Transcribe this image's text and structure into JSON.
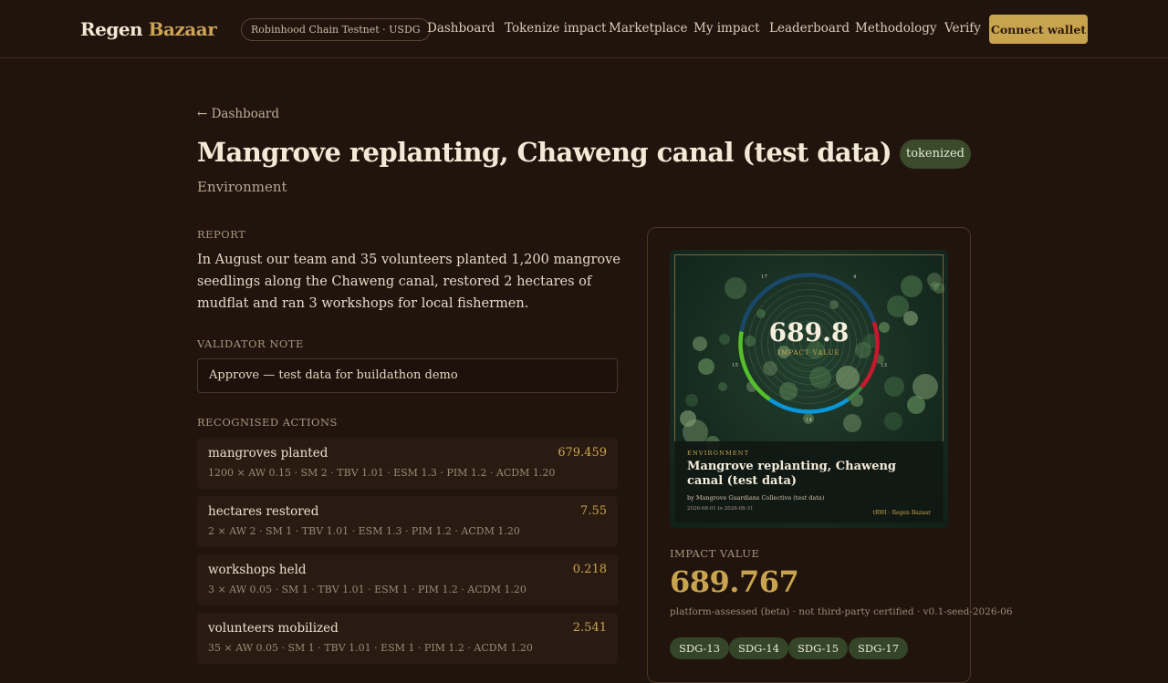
{
  "header": {
    "brand_part1": "Regen",
    "brand_part2": "Bazaar",
    "chain": "Robinhood Chain Testnet · USDG",
    "nav": [
      {
        "label": "Dashboard"
      },
      {
        "label": "Tokenize impact"
      },
      {
        "label": "Marketplace"
      },
      {
        "label": "My impact"
      },
      {
        "label": "Leaderboard"
      },
      {
        "label": "Methodology"
      },
      {
        "label": "Verify"
      }
    ],
    "connect_label": "Connect wallet"
  },
  "page": {
    "back_label": "← Dashboard",
    "title": "Mangrove replanting, Chaweng canal (test data)",
    "category": "Environment",
    "status": "tokenized"
  },
  "report": {
    "label": "REPORT",
    "text": "In August our team and 35 volunteers planted 1,200 mangrove seedlings along the Chaweng canal, restored 2 hectares of mudflat and ran 3 workshops for local fishermen."
  },
  "validator": {
    "label": "VALIDATOR NOTE",
    "note": "Approve — test data for buildathon demo"
  },
  "actions": {
    "label": "RECOGNISED ACTIONS",
    "items": [
      {
        "name": "mangroves planted",
        "value": "679.459",
        "formula": "1200 × AW 0.15 · SM 2 · TBV 1.01 · ESM 1.3 · PIM 1.2 · ACDM 1.20"
      },
      {
        "name": "hectares restored",
        "value": "7.55",
        "formula": "2 × AW 2 · SM 1 · TBV 1.01 · ESM 1.3 · PIM 1.2 · ACDM 1.20"
      },
      {
        "name": "workshops held",
        "value": "0.218",
        "formula": "3 × AW 0.05 · SM 1 · TBV 1.01 · ESM 1 · PIM 1.2 · ACDM 1.20"
      },
      {
        "name": "volunteers mobilized",
        "value": "2.541",
        "formula": "35 × AW 0.05 · SM 1 · TBV 1.01 · ESM 1 · PIM 1.2 · ACDM 1.20"
      }
    ]
  },
  "nft": {
    "score": "689.8",
    "score_label": "IMPACT VALUE",
    "sdg_marks": [
      "17",
      "4",
      "15",
      "13",
      "14"
    ],
    "category": "ENVIRONMENT",
    "title": "Mangrove replanting, Chaweng canal (test data)",
    "by": "by Mangrove Guardians Collective (test data)",
    "dates": "2026-08-01 to 2026-08-31",
    "mark": "tRWI · Regen Bazaar",
    "colors": {
      "sdg13": "#3f7e44",
      "sdg14": "#0a97d9",
      "sdg15": "#56c02b",
      "sdg17": "#19486a",
      "sdg4": "#c5192d"
    }
  },
  "impact": {
    "label": "IMPACT VALUE",
    "value": "689.767",
    "note": "platform-assessed (beta) · not third-party certified · v0.1-seed-2026-06",
    "sdgs": [
      "SDG-13",
      "SDG-14",
      "SDG-15",
      "SDG-17"
    ]
  }
}
